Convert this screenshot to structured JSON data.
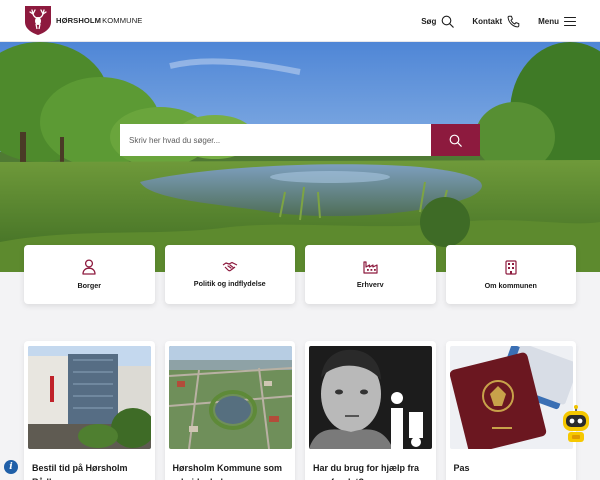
{
  "brand": {
    "name_bold": "HØRSHOLM",
    "name_regular": "KOMMUNE",
    "accent_color": "#8d1a3e"
  },
  "nav": {
    "search_label": "Søg",
    "contact_label": "Kontakt",
    "menu_label": "Menu"
  },
  "hero": {
    "search_placeholder": "Skriv her hvad du søger..."
  },
  "categories": [
    {
      "label": "Borger",
      "icon": "person-icon"
    },
    {
      "label": "Politik og indflydelse",
      "icon": "handshake-icon"
    },
    {
      "label": "Erhverv",
      "icon": "factory-icon"
    },
    {
      "label": "Om kommunen",
      "icon": "building-icon"
    }
  ],
  "news": [
    {
      "title": "Bestil tid på Hørsholm Rådhus",
      "image": "town-hall-photo"
    },
    {
      "title": "Hørsholm Kommune som arbejdsplads",
      "image": "aerial-town-photo"
    },
    {
      "title": "Har du brug for hjælp fra samfundet?",
      "image": "boy-portrait-photo"
    },
    {
      "title": "Pas",
      "image": "passport-photo"
    }
  ]
}
